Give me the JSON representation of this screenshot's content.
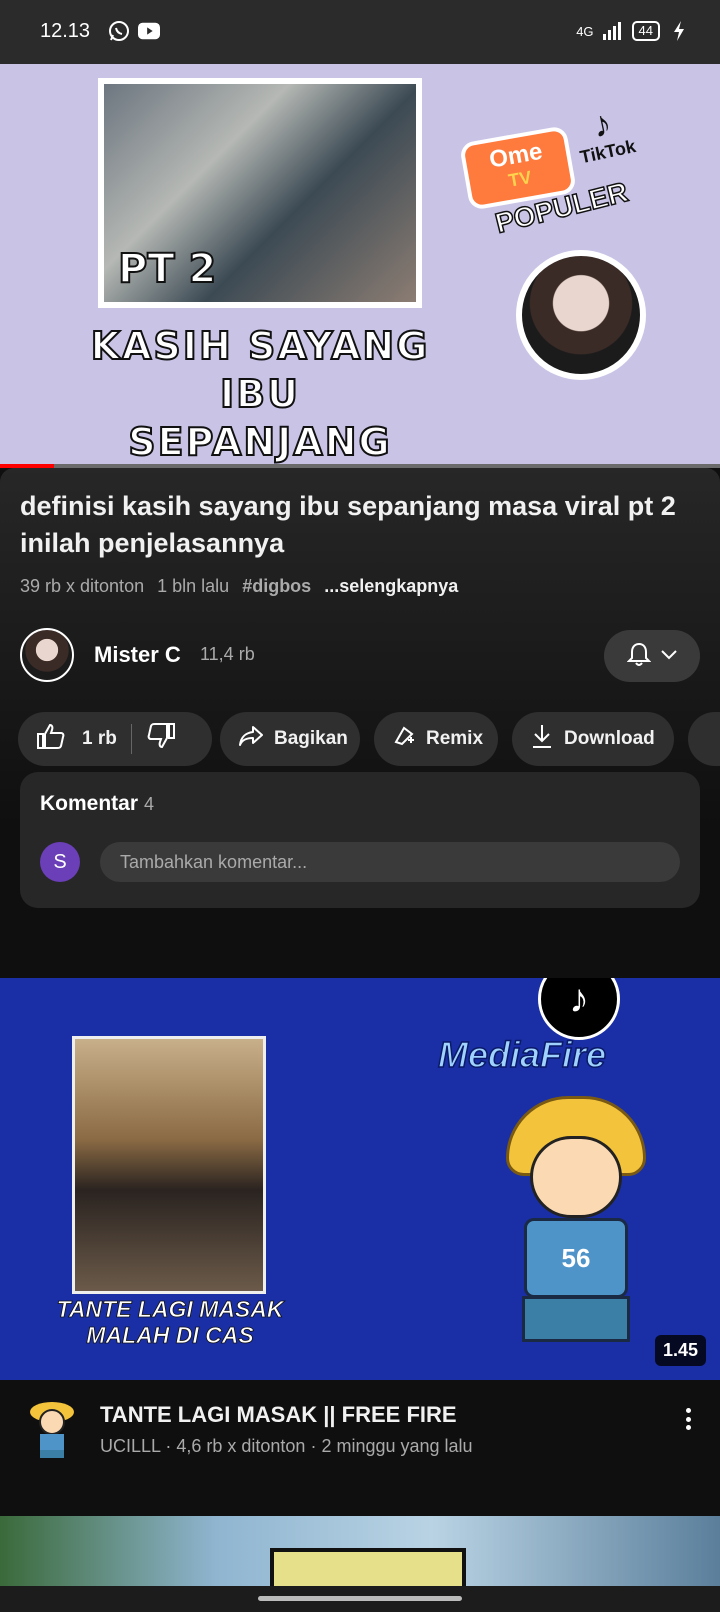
{
  "status_bar": {
    "time": "12.13",
    "network": "4G",
    "battery": "44",
    "icons": [
      "whatsapp-icon",
      "youtube-icon",
      "signal-icon",
      "charging-icon"
    ]
  },
  "hero": {
    "frame_text": "PT 2",
    "headline_line1": "KASIH SAYANG IBU",
    "headline_line2": "SEPANJANG MASA",
    "ome_brand": "Ome",
    "ome_tv": "TV",
    "tiktok_brand": "TikTok",
    "populer": "POPULER",
    "progress_fraction": 0.075
  },
  "video": {
    "title": "definisi kasih sayang ibu sepanjang masa viral pt 2 inilah penjelasannya",
    "views": "39 rb x ditonton",
    "age": "1 bln lalu",
    "hashtag": "#digbos",
    "more": "...selengkapnya"
  },
  "channel": {
    "name": "Mister C",
    "subscribers": "11,4 rb"
  },
  "actions": {
    "likes": "1 rb",
    "share": "Bagikan",
    "remix": "Remix",
    "download": "Download"
  },
  "comments": {
    "title": "Komentar",
    "count": "4",
    "avatar_letter": "S",
    "placeholder": "Tambahkan komentar..."
  },
  "next_video": {
    "caption_line1": "TANTE LAGI MASAK",
    "caption_line2": "MALAH DI CAS",
    "mediafire": "MediaFire",
    "shirt_number": "56",
    "duration": "1.45",
    "title": "TANTE LAGI MASAK || FREE FIRE",
    "meta": "UCILLL · 4,6 rb x ditonton · 2 minggu yang lalu"
  },
  "colors": {
    "background": "#0f0f0f",
    "progress": "#ff0000",
    "pill": "#2f2f2f",
    "comment_avatar": "#6a3fb8"
  }
}
